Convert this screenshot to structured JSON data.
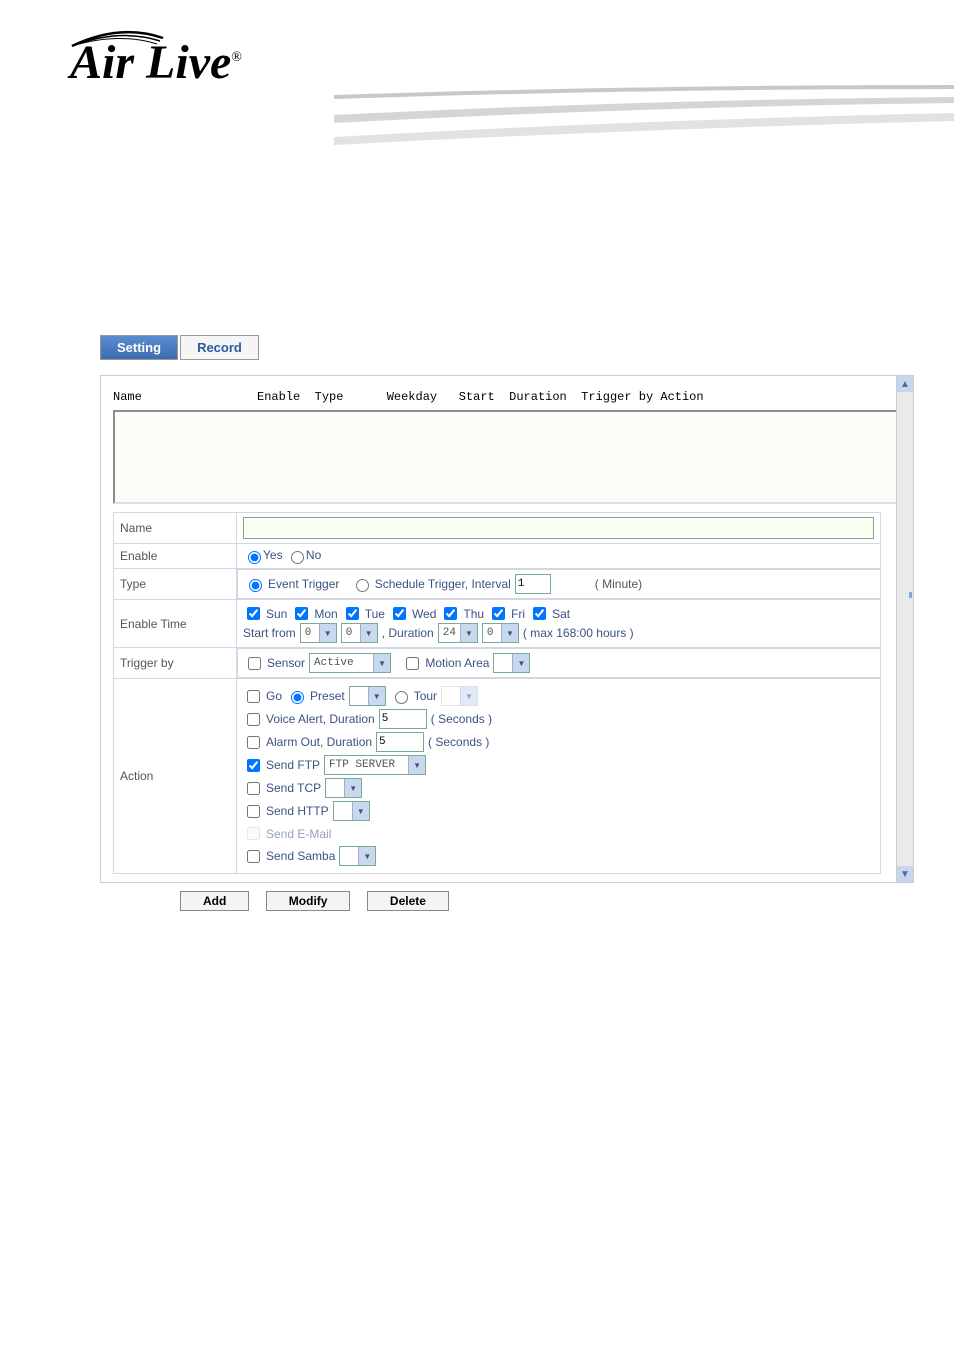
{
  "logo": {
    "text": "Air Live",
    "trademark": "®"
  },
  "tabs": {
    "setting": "Setting",
    "record": "Record"
  },
  "list_headers": {
    "name": "Name",
    "enable": "Enable",
    "type": "Type",
    "weekday": "Weekday",
    "start": "Start",
    "duration": "Duration",
    "trigger_by": "Trigger by",
    "action": "Action"
  },
  "form": {
    "name": {
      "label": "Name",
      "value": ""
    },
    "enable": {
      "label": "Enable",
      "yes": "Yes",
      "no": "No"
    },
    "type": {
      "label": "Type",
      "event": "Event Trigger",
      "schedule": "Schedule Trigger, Interval",
      "interval_value": "1",
      "minute": "( Minute)"
    },
    "enable_time": {
      "label": "Enable Time",
      "days": {
        "sun": "Sun",
        "mon": "Mon",
        "tue": "Tue",
        "wed": "Wed",
        "thu": "Thu",
        "fri": "Fri",
        "sat": "Sat"
      },
      "start_from": "Start from",
      "h1": "0",
      "m1": "0",
      "duration": ", Duration",
      "h2": "24",
      "m2": "0",
      "max": "( max 168:00 hours )"
    },
    "trigger_by": {
      "label": "Trigger by",
      "sensor": "Sensor",
      "sensor_val": "Active",
      "motion": "Motion Area",
      "motion_val": ""
    },
    "action": {
      "label": "Action",
      "go": "Go",
      "preset": "Preset",
      "preset_val": "",
      "tour": "Tour",
      "tour_val": "",
      "voice": "Voice Alert, Duration",
      "voice_val": "5",
      "seconds": "( Seconds )",
      "alarm": "Alarm Out, Duration",
      "alarm_val": "5",
      "ftp": "Send FTP",
      "ftp_val": "FTP SERVER",
      "tcp": "Send TCP",
      "tcp_val": "",
      "http": "Send HTTP",
      "http_val": "",
      "email": "Send E-Mail",
      "samba": "Send Samba",
      "samba_val": ""
    }
  },
  "buttons": {
    "add": "Add",
    "modify": "Modify",
    "delete": "Delete"
  }
}
